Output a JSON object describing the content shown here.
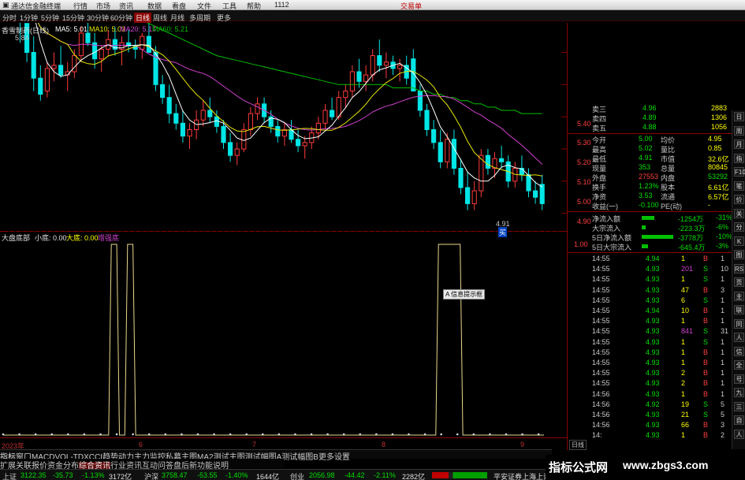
{
  "titlebar": {
    "app": "通达信金融终端",
    "menus": [
      "行情",
      "市场",
      "资讯",
      "数据",
      "看盘",
      "文件",
      "工具",
      "帮助"
    ],
    "code": "1112",
    "trade": "交易单"
  },
  "timeframes": [
    "分时",
    "1分钟",
    "5分钟",
    "15分钟",
    "30分钟",
    "60分钟",
    "日线",
    "周线",
    "月线",
    "多周期",
    "更多"
  ],
  "main_header": {
    "title": "香雪制药(日线)",
    "ma5": "MA5: 5.01",
    "ma10": "MA10: 5.03",
    "ma20": "MA20: 5.17",
    "ma60": "MA60: 5.21",
    "high_label": "5.84",
    "low_label": "4.91"
  },
  "price_axis": [
    "5.40",
    "5.30",
    "5.20",
    "5.10",
    "5.00",
    "4.90"
  ],
  "sub_header": {
    "name": "大盘底部",
    "small": "小底: 0.00",
    "big": "大底: 0.00",
    "tag": "增强底"
  },
  "sub_axis": [
    "1.00"
  ],
  "tooltip": "A 信息提示框",
  "date_axis": {
    "start": "2023年",
    "marks": [
      "6",
      "7",
      "8",
      "9"
    ]
  },
  "signal_mark": "买",
  "quote": {
    "asks": [
      {
        "label": "卖三",
        "price": "4.96",
        "vol": "2883"
      },
      {
        "label": "卖四",
        "price": "4.89",
        "vol": "1306"
      },
      {
        "label": "卖五",
        "price": "4.88",
        "vol": "1056"
      }
    ],
    "stats": [
      {
        "k1": "今开",
        "v1": "5.00",
        "k2": "均价",
        "v2": "4.95"
      },
      {
        "k1": "最高",
        "v1": "5.02",
        "k2": "量比",
        "v2": "0.85"
      },
      {
        "k1": "最低",
        "v1": "4.91",
        "k2": "市值",
        "v2": "32.6亿"
      },
      {
        "k1": "现量",
        "v1": "353",
        "k2": "总量",
        "v2": "80845"
      },
      {
        "k1": "外盘",
        "v1": "27553",
        "k2": "内盘",
        "v2": "53292"
      },
      {
        "k1": "换手",
        "v1": "1.23%",
        "k2": "股本",
        "v2": "6.61亿"
      },
      {
        "k1": "净资",
        "v1": "3.53",
        "k2": "流通",
        "v2": "6.57亿"
      },
      {
        "k1": "收益(一)",
        "v1": "-0.100",
        "k2": "PE(动)",
        "v2": "-"
      }
    ],
    "flows": [
      {
        "label": "净流入额",
        "val": "-1254万",
        "pct": "-31%",
        "bar": 0.4
      },
      {
        "label": "大宗流入",
        "val": "-223.3万",
        "pct": "-6%",
        "bar": 0.12
      },
      {
        "label": "5日净流入额",
        "val": "-3778万",
        "pct": "-10%",
        "bar": 1.0
      },
      {
        "label": "5日大宗流入",
        "val": "-645.4万",
        "pct": "-3%",
        "bar": 0.2
      }
    ]
  },
  "ticks": [
    {
      "t": "14:55",
      "p": "4.94",
      "v": "1",
      "d": "B",
      "n": "1"
    },
    {
      "t": "14:55",
      "p": "4.93",
      "v": "201",
      "d": "S",
      "n": "10"
    },
    {
      "t": "14:55",
      "p": "4.93",
      "v": "1",
      "d": "S",
      "n": "1"
    },
    {
      "t": "14:55",
      "p": "4.93",
      "v": "47",
      "d": "B",
      "n": "3"
    },
    {
      "t": "14:55",
      "p": "4.93",
      "v": "6",
      "d": "S",
      "n": "1"
    },
    {
      "t": "14:55",
      "p": "4.94",
      "v": "10",
      "d": "B",
      "n": "1"
    },
    {
      "t": "14:55",
      "p": "4.93",
      "v": "1",
      "d": "B",
      "n": "1"
    },
    {
      "t": "14:55",
      "p": "4.93",
      "v": "841",
      "d": "S",
      "n": "31"
    },
    {
      "t": "14:55",
      "p": "4.93",
      "v": "1",
      "d": "S",
      "n": "1"
    },
    {
      "t": "14:55",
      "p": "4.93",
      "v": "1",
      "d": "B",
      "n": "1"
    },
    {
      "t": "14:55",
      "p": "4.93",
      "v": "1",
      "d": "B",
      "n": "1"
    },
    {
      "t": "14:55",
      "p": "4.93",
      "v": "2",
      "d": "B",
      "n": "1"
    },
    {
      "t": "14:55",
      "p": "4.93",
      "v": "2",
      "d": "B",
      "n": "1"
    },
    {
      "t": "14:56",
      "p": "4.93",
      "v": "1",
      "d": "B",
      "n": "1"
    },
    {
      "t": "14:56",
      "p": "4.92",
      "v": "19",
      "d": "S",
      "n": "5"
    },
    {
      "t": "14:56",
      "p": "4.93",
      "v": "21",
      "d": "S",
      "n": "5"
    },
    {
      "t": "14:56",
      "p": "4.93",
      "v": "66",
      "d": "B",
      "n": "3"
    },
    {
      "t": "14:",
      "p": "4.93",
      "v": "1",
      "d": "B",
      "n": "2"
    }
  ],
  "tick_footer": "日线",
  "iconbar": [
    "日",
    "周",
    "月",
    "指",
    "F10",
    "笔",
    "价",
    "关",
    "分",
    "K",
    "图",
    "RS",
    "页",
    "主",
    "联",
    "同",
    "人",
    "信",
    "全",
    "号",
    "九",
    "三",
    "自",
    "人"
  ],
  "tabs": [
    "指标",
    "窗口",
    "MACD",
    "VOL-TDX",
    "CCI",
    "趋势动力",
    "主力监控",
    "私募主图",
    "MA2",
    "测试主图",
    "测试幅图A",
    "测试幅图B",
    "更多",
    "设置"
  ],
  "tabs2": [
    "扩展",
    "关联报价",
    "资金分布",
    "综合资讯",
    "行业资讯",
    "互动问答",
    "盘后新功能说明"
  ],
  "status": {
    "sh": {
      "name": "上证",
      "val": "3122.35",
      "chg": "-35.73",
      "pct": "-1.13%",
      "amt": "3172亿"
    },
    "sz": {
      "name": "沪深",
      "val": "3758.47",
      "chg": "-53.55",
      "pct": "-1.40%",
      "amt": "1644亿"
    },
    "cy": {
      "name": "创业",
      "val": "2056.98",
      "chg": "-44.42",
      "pct": "-2.11%",
      "amt": "2282亿"
    },
    "broker": "平安证券上海上证"
  },
  "banner": {
    "text": "指标公式网",
    "url": "www.zbgs3.com"
  },
  "colors": {
    "up": "#ff3b3b",
    "down": "#00e5e5",
    "bg": "#000000",
    "grid": "#8a0000",
    "ma5": "#ffffff",
    "ma10": "#e6e600",
    "ma20": "#d040d0",
    "ma60": "#00c000",
    "signal": "#e8d890"
  },
  "chart_data": {
    "type": "candlestick",
    "title": "香雪制药(日线)",
    "ylim": [
      4.86,
      5.46
    ],
    "candles": [
      [
        5.63,
        5.84,
        5.59,
        5.71
      ],
      [
        5.72,
        5.8,
        5.6,
        5.67
      ],
      [
        5.68,
        5.7,
        5.43,
        5.5
      ],
      [
        5.49,
        5.53,
        5.37,
        5.4
      ],
      [
        5.4,
        5.45,
        5.28,
        5.32
      ],
      [
        5.32,
        5.36,
        5.25,
        5.27
      ],
      [
        5.28,
        5.37,
        5.26,
        5.35
      ],
      [
        5.35,
        5.4,
        5.31,
        5.36
      ],
      [
        5.36,
        5.42,
        5.32,
        5.33
      ],
      [
        5.33,
        5.37,
        5.28,
        5.34
      ],
      [
        5.34,
        5.41,
        5.32,
        5.39
      ],
      [
        5.39,
        5.48,
        5.37,
        5.46
      ],
      [
        5.46,
        5.52,
        5.42,
        5.43
      ],
      [
        5.43,
        5.46,
        5.35,
        5.38
      ],
      [
        5.38,
        5.42,
        5.34,
        5.41
      ],
      [
        5.41,
        5.47,
        5.39,
        5.44
      ],
      [
        5.44,
        5.48,
        5.39,
        5.41
      ],
      [
        5.41,
        5.45,
        5.36,
        5.43
      ],
      [
        5.43,
        5.47,
        5.4,
        5.42
      ],
      [
        5.42,
        5.44,
        5.38,
        5.41
      ],
      [
        5.41,
        5.46,
        5.38,
        5.45
      ],
      [
        5.45,
        5.5,
        5.42,
        5.4
      ],
      [
        5.4,
        5.42,
        5.28,
        5.3
      ],
      [
        5.3,
        5.33,
        5.24,
        5.26
      ],
      [
        5.26,
        5.3,
        5.18,
        5.21
      ],
      [
        5.21,
        5.24,
        5.16,
        5.18
      ],
      [
        5.18,
        5.22,
        5.12,
        5.14
      ],
      [
        5.14,
        5.18,
        5.1,
        5.16
      ],
      [
        5.16,
        5.22,
        5.13,
        5.19
      ],
      [
        5.19,
        5.25,
        5.17,
        5.22
      ],
      [
        5.22,
        5.26,
        5.18,
        5.2
      ],
      [
        5.2,
        5.22,
        5.15,
        5.17
      ],
      [
        5.17,
        5.19,
        5.1,
        5.12
      ],
      [
        5.12,
        5.15,
        5.06,
        5.08
      ],
      [
        5.08,
        5.12,
        5.05,
        5.1
      ],
      [
        5.1,
        5.18,
        5.09,
        5.16
      ],
      [
        5.16,
        5.23,
        5.14,
        5.21
      ],
      [
        5.21,
        5.26,
        5.19,
        5.24
      ],
      [
        5.24,
        5.26,
        5.18,
        5.2
      ],
      [
        5.2,
        5.22,
        5.15,
        5.17
      ],
      [
        5.17,
        5.19,
        5.12,
        5.14
      ],
      [
        5.14,
        5.18,
        5.11,
        5.16
      ],
      [
        5.16,
        5.19,
        5.12,
        5.13
      ],
      [
        5.13,
        5.16,
        5.09,
        5.11
      ],
      [
        5.11,
        5.14,
        5.07,
        5.12
      ],
      [
        5.12,
        5.17,
        5.1,
        5.15
      ],
      [
        5.15,
        5.2,
        5.13,
        5.18
      ],
      [
        5.18,
        5.24,
        5.16,
        5.22
      ],
      [
        5.22,
        5.26,
        5.19,
        5.2
      ],
      [
        5.2,
        5.28,
        5.19,
        5.26
      ],
      [
        5.26,
        5.3,
        5.23,
        5.28
      ],
      [
        5.28,
        5.36,
        5.26,
        5.34
      ],
      [
        5.34,
        5.38,
        5.29,
        5.31
      ],
      [
        5.31,
        5.36,
        5.28,
        5.33
      ],
      [
        5.33,
        5.41,
        5.31,
        5.39
      ],
      [
        5.39,
        5.44,
        5.34,
        5.36
      ],
      [
        5.36,
        5.4,
        5.32,
        5.37
      ],
      [
        5.37,
        5.39,
        5.33,
        5.35
      ],
      [
        5.35,
        5.38,
        5.31,
        5.36
      ],
      [
        5.36,
        5.39,
        5.3,
        5.32
      ],
      [
        5.38,
        5.41,
        5.29,
        5.28
      ],
      [
        5.28,
        5.3,
        5.2,
        5.22
      ],
      [
        5.22,
        5.24,
        5.14,
        5.16
      ],
      [
        5.16,
        5.19,
        5.1,
        5.12
      ],
      [
        5.12,
        5.16,
        5.04,
        5.06
      ],
      [
        5.06,
        5.15,
        5.04,
        5.13
      ],
      [
        5.13,
        5.16,
        5.02,
        5.04
      ],
      [
        5.04,
        5.07,
        4.96,
        4.98
      ],
      [
        4.98,
        5.03,
        4.91,
        4.93
      ],
      [
        4.93,
        5.0,
        4.91,
        4.97
      ],
      [
        4.97,
        5.1,
        4.95,
        5.08
      ],
      [
        5.08,
        5.1,
        5.02,
        5.04
      ],
      [
        5.04,
        5.09,
        5.01,
        5.07
      ],
      [
        5.07,
        5.11,
        5.04,
        5.06
      ],
      [
        5.06,
        5.08,
        4.98,
        5.0
      ],
      [
        5.0,
        5.06,
        4.98,
        5.04
      ],
      [
        5.04,
        5.08,
        5.0,
        5.02
      ],
      [
        5.02,
        5.04,
        4.95,
        4.97
      ],
      [
        4.97,
        5.0,
        4.93,
        4.95
      ],
      [
        4.99,
        5.02,
        4.91,
        4.93
      ]
    ],
    "ma60": [
      5.7,
      5.69,
      5.68,
      5.67,
      5.66,
      5.65,
      5.64,
      5.63,
      5.62,
      5.61,
      5.6,
      5.59,
      5.58,
      5.57,
      5.56,
      5.55,
      5.54,
      5.53,
      5.52,
      5.51,
      5.5,
      5.49,
      5.48,
      5.47,
      5.46,
      5.45,
      5.44,
      5.43,
      5.42,
      5.41,
      5.4,
      5.39,
      5.385,
      5.38,
      5.375,
      5.37,
      5.365,
      5.36,
      5.355,
      5.35,
      5.345,
      5.34,
      5.335,
      5.33,
      5.325,
      5.32,
      5.315,
      5.31,
      5.305,
      5.3,
      5.3,
      5.3,
      5.3,
      5.3,
      5.3,
      5.3,
      5.3,
      5.29,
      5.29,
      5.29,
      5.29,
      5.28,
      5.28,
      5.27,
      5.27,
      5.26,
      5.26,
      5.25,
      5.25,
      5.24,
      5.24,
      5.23,
      5.23,
      5.22,
      5.22,
      5.22,
      5.21,
      5.21,
      5.21,
      5.21
    ],
    "signal": {
      "x": [
        0,
        39,
        40,
        42,
        43,
        45,
        46,
        48,
        49,
        51,
        52,
        160,
        161,
        163,
        164,
        166,
        167,
        169,
        170,
        172,
        173,
        200
      ],
      "y": [
        0,
        0,
        1,
        1,
        0,
        0,
        1,
        1,
        0,
        0,
        0,
        0,
        1,
        1,
        1,
        1,
        1,
        1,
        0,
        0,
        0,
        0
      ],
      "segments": [
        [
          39,
          43
        ],
        [
          46,
          48
        ],
        [
          160,
          168
        ]
      ]
    }
  }
}
